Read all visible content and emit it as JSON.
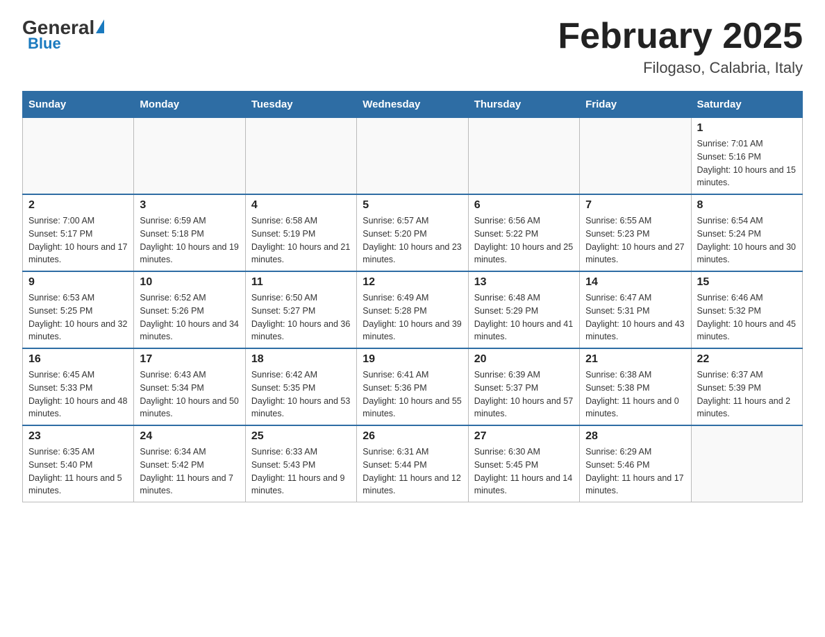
{
  "header": {
    "logo_general": "General",
    "logo_blue": "Blue",
    "month_title": "February 2025",
    "location": "Filogaso, Calabria, Italy"
  },
  "days_of_week": [
    "Sunday",
    "Monday",
    "Tuesday",
    "Wednesday",
    "Thursday",
    "Friday",
    "Saturday"
  ],
  "weeks": [
    [
      {
        "day": "",
        "info": ""
      },
      {
        "day": "",
        "info": ""
      },
      {
        "day": "",
        "info": ""
      },
      {
        "day": "",
        "info": ""
      },
      {
        "day": "",
        "info": ""
      },
      {
        "day": "",
        "info": ""
      },
      {
        "day": "1",
        "info": "Sunrise: 7:01 AM\nSunset: 5:16 PM\nDaylight: 10 hours and 15 minutes."
      }
    ],
    [
      {
        "day": "2",
        "info": "Sunrise: 7:00 AM\nSunset: 5:17 PM\nDaylight: 10 hours and 17 minutes."
      },
      {
        "day": "3",
        "info": "Sunrise: 6:59 AM\nSunset: 5:18 PM\nDaylight: 10 hours and 19 minutes."
      },
      {
        "day": "4",
        "info": "Sunrise: 6:58 AM\nSunset: 5:19 PM\nDaylight: 10 hours and 21 minutes."
      },
      {
        "day": "5",
        "info": "Sunrise: 6:57 AM\nSunset: 5:20 PM\nDaylight: 10 hours and 23 minutes."
      },
      {
        "day": "6",
        "info": "Sunrise: 6:56 AM\nSunset: 5:22 PM\nDaylight: 10 hours and 25 minutes."
      },
      {
        "day": "7",
        "info": "Sunrise: 6:55 AM\nSunset: 5:23 PM\nDaylight: 10 hours and 27 minutes."
      },
      {
        "day": "8",
        "info": "Sunrise: 6:54 AM\nSunset: 5:24 PM\nDaylight: 10 hours and 30 minutes."
      }
    ],
    [
      {
        "day": "9",
        "info": "Sunrise: 6:53 AM\nSunset: 5:25 PM\nDaylight: 10 hours and 32 minutes."
      },
      {
        "day": "10",
        "info": "Sunrise: 6:52 AM\nSunset: 5:26 PM\nDaylight: 10 hours and 34 minutes."
      },
      {
        "day": "11",
        "info": "Sunrise: 6:50 AM\nSunset: 5:27 PM\nDaylight: 10 hours and 36 minutes."
      },
      {
        "day": "12",
        "info": "Sunrise: 6:49 AM\nSunset: 5:28 PM\nDaylight: 10 hours and 39 minutes."
      },
      {
        "day": "13",
        "info": "Sunrise: 6:48 AM\nSunset: 5:29 PM\nDaylight: 10 hours and 41 minutes."
      },
      {
        "day": "14",
        "info": "Sunrise: 6:47 AM\nSunset: 5:31 PM\nDaylight: 10 hours and 43 minutes."
      },
      {
        "day": "15",
        "info": "Sunrise: 6:46 AM\nSunset: 5:32 PM\nDaylight: 10 hours and 45 minutes."
      }
    ],
    [
      {
        "day": "16",
        "info": "Sunrise: 6:45 AM\nSunset: 5:33 PM\nDaylight: 10 hours and 48 minutes."
      },
      {
        "day": "17",
        "info": "Sunrise: 6:43 AM\nSunset: 5:34 PM\nDaylight: 10 hours and 50 minutes."
      },
      {
        "day": "18",
        "info": "Sunrise: 6:42 AM\nSunset: 5:35 PM\nDaylight: 10 hours and 53 minutes."
      },
      {
        "day": "19",
        "info": "Sunrise: 6:41 AM\nSunset: 5:36 PM\nDaylight: 10 hours and 55 minutes."
      },
      {
        "day": "20",
        "info": "Sunrise: 6:39 AM\nSunset: 5:37 PM\nDaylight: 10 hours and 57 minutes."
      },
      {
        "day": "21",
        "info": "Sunrise: 6:38 AM\nSunset: 5:38 PM\nDaylight: 11 hours and 0 minutes."
      },
      {
        "day": "22",
        "info": "Sunrise: 6:37 AM\nSunset: 5:39 PM\nDaylight: 11 hours and 2 minutes."
      }
    ],
    [
      {
        "day": "23",
        "info": "Sunrise: 6:35 AM\nSunset: 5:40 PM\nDaylight: 11 hours and 5 minutes."
      },
      {
        "day": "24",
        "info": "Sunrise: 6:34 AM\nSunset: 5:42 PM\nDaylight: 11 hours and 7 minutes."
      },
      {
        "day": "25",
        "info": "Sunrise: 6:33 AM\nSunset: 5:43 PM\nDaylight: 11 hours and 9 minutes."
      },
      {
        "day": "26",
        "info": "Sunrise: 6:31 AM\nSunset: 5:44 PM\nDaylight: 11 hours and 12 minutes."
      },
      {
        "day": "27",
        "info": "Sunrise: 6:30 AM\nSunset: 5:45 PM\nDaylight: 11 hours and 14 minutes."
      },
      {
        "day": "28",
        "info": "Sunrise: 6:29 AM\nSunset: 5:46 PM\nDaylight: 11 hours and 17 minutes."
      },
      {
        "day": "",
        "info": ""
      }
    ]
  ]
}
